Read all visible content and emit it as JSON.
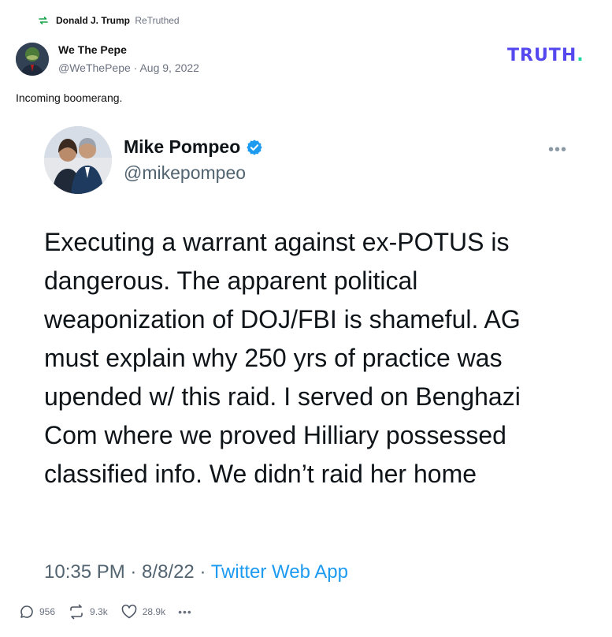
{
  "retruth": {
    "name": "Donald J. Trump",
    "verb": "ReTruthed",
    "icon": "retruth-icon"
  },
  "author": {
    "name": "We The Pepe",
    "handle": "@WeThePepe",
    "date": "Aug 9, 2022",
    "separator": " · "
  },
  "brand": {
    "logo_text": "TRUTH",
    "logo_dot": ".",
    "colors": {
      "primary": "#5448ee",
      "accent": "#17d6a0"
    }
  },
  "post": {
    "text": "Incoming boomerang."
  },
  "embedded_tweet": {
    "name": "Mike Pompeo",
    "handle": "@mikepompeo",
    "verified_icon": "verified-badge-icon",
    "body": "Executing a warrant against ex-POTUS is dangerous. The apparent political weaponization of DOJ/FBI is shameful. AG must explain why 250 yrs of practice was upended w/ this raid. I served on Benghazi Com where we proved Hilliary possessed classified info. We didn’t raid her home",
    "time": "10:35 PM · 8/8/22 · ",
    "app": "Twitter Web App",
    "more_icon": "•••"
  },
  "actions": {
    "replies": "956",
    "retruths": "9.3k",
    "likes": "28.9k",
    "more": "•••"
  }
}
